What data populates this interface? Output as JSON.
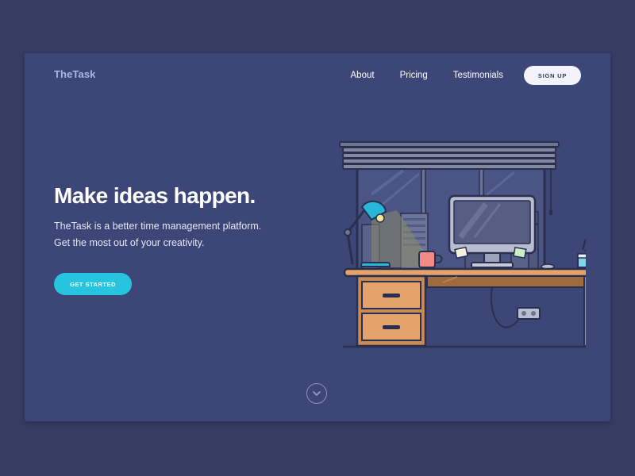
{
  "header": {
    "logo": "TheTask",
    "nav": [
      "About",
      "Pricing",
      "Testimonials"
    ],
    "signup_label": "SIGN UP"
  },
  "hero": {
    "title": "Make ideas happen.",
    "subtitle_lines": [
      "TheTask is a better time management platform.",
      "Get the most out of your creativity."
    ],
    "cta_label": "GET STARTED"
  },
  "illustration": {
    "name": "desk-workspace-illustration"
  },
  "scroll": {
    "icon": "chevron-down-icon"
  },
  "colors": {
    "background": "#363c62",
    "card": "#3c4677",
    "accent": "#27c4df",
    "logo": "#aab6e8"
  }
}
